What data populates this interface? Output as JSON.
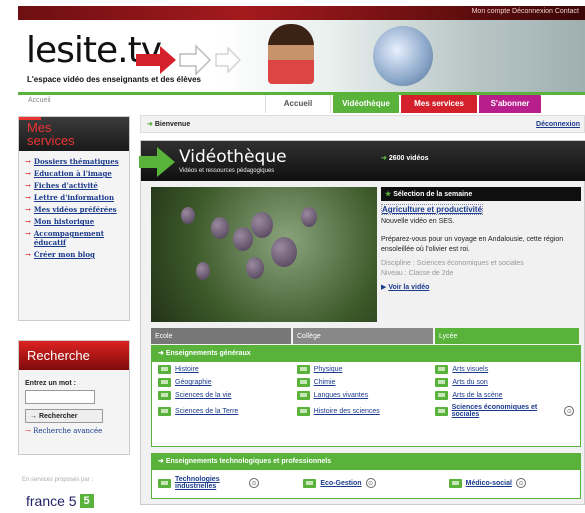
{
  "header": {
    "top_links": "Mon compte  Déconnexion  Contact",
    "logo": "lesite.tv",
    "tagline": "L'espace vidéo des enseignants et des élèves",
    "tabs": [
      "Accueil",
      "Vidéothèque",
      "Mes services",
      "S'abonner"
    ]
  },
  "breadcrumb": "Accueil",
  "services": {
    "title_line1": "Mes",
    "title_line2": "services",
    "items": [
      "Dossiers thématiques",
      "Education à l'image",
      "Fiches d'activité",
      "Lettre d'information",
      "Mes vidéos préférées",
      "Mon historique",
      "Accompagnement éducatif",
      "Créer mon blog"
    ]
  },
  "search": {
    "title": "Recherche",
    "label": "Entrez un mot :",
    "button": "Rechercher",
    "advanced": "Recherche avancée"
  },
  "partner": {
    "text": "En services proposés par :",
    "logo": "france 5"
  },
  "welcome": {
    "text": "Bienvenue",
    "logout": "Déconnexion"
  },
  "videotheque": {
    "title": "Vidéothèque",
    "subtitle": "Vidéos et ressources pédagogiques",
    "count": "2600 vidéos"
  },
  "selection": {
    "heading": "Sélection de la semaine",
    "title": "Agriculture et productivité",
    "line1": "Nouvelle vidéo en SES.",
    "desc": "Préparez-vous pour un voyage en Andalousie, cette région ensoleillée où l'olivier est roi.",
    "discipline": "Discipline : Sciences économiques et sociales",
    "niveau": "Niveau : Classe de 2de",
    "link": "Voir la vidéo"
  },
  "levels": [
    "Ecole",
    "Collège",
    "Lycée"
  ],
  "general": {
    "heading": "Enseignements généraux",
    "items": [
      "Histoire",
      "Physique",
      "Arts visuels",
      "Géographie",
      "Chimie",
      "Arts du son",
      "Sciences de la vie",
      "Langues vivantes",
      "Arts de la scène",
      "Sciences de la Terre",
      "Histoire des sciences",
      "Sciences économiques et sociales"
    ]
  },
  "tech": {
    "heading": "Enseignements technologiques et professionnels",
    "items": [
      "Technologies industrielles",
      "Eco-Gestion",
      "Médico-social"
    ]
  },
  "colors": {
    "green": "#59b33b",
    "red": "#d4202a",
    "magenta": "#b91f8c"
  }
}
